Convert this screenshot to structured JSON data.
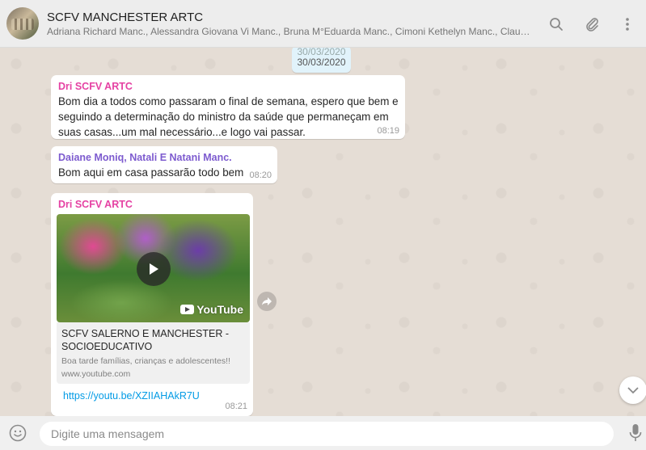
{
  "header": {
    "title": "SCFV MANCHESTER ARTC",
    "members": "Adriana Richard Manc., Alessandra Giovana Vi Manc., Bruna M°Eduarda Manc., Cimoni Kethelyn Manc., Claudia Maria Clar...",
    "icons": [
      "search-icon",
      "paperclip-icon",
      "menu-icon"
    ]
  },
  "date_separator": {
    "ghost": "30/03/2020",
    "label": "30/03/2020"
  },
  "messages": [
    {
      "sender": "Dri SCFV ARTC",
      "sender_color": "#e542a3",
      "text": "Bom dia a todos como passaram o final de semana, espero que bem e seguindo a determinação do ministro da saúde que permaneçam em suas casas...um mal necessário...e logo vai passar.",
      "time": "08:19"
    },
    {
      "sender": "Daiane Moniq, Natali E Natani Manc.",
      "sender_color": "#7d5bcf",
      "text": "Bom  aqui em casa passarão  todo bem",
      "time": "08:20"
    },
    {
      "sender": "Dri SCFV ARTC",
      "sender_color": "#e542a3",
      "video_badge": "YouTube",
      "preview_title": "SCFV SALERNO E MANCHESTER - SOCIOEDUCATIVO",
      "preview_desc": "Boa tarde famílias, crianças e adolescentes!!",
      "preview_site": "www.youtube.com",
      "link": "https://youtu.be/XZIIAHAkR7U",
      "time": "08:21"
    }
  ],
  "footer": {
    "placeholder": "Digite uma mensagem"
  },
  "colors": {
    "header_bg": "#ededed",
    "chat_bg": "#e5ddd5",
    "date_pill_bg": "#e1f3fb",
    "link": "#039be5"
  }
}
